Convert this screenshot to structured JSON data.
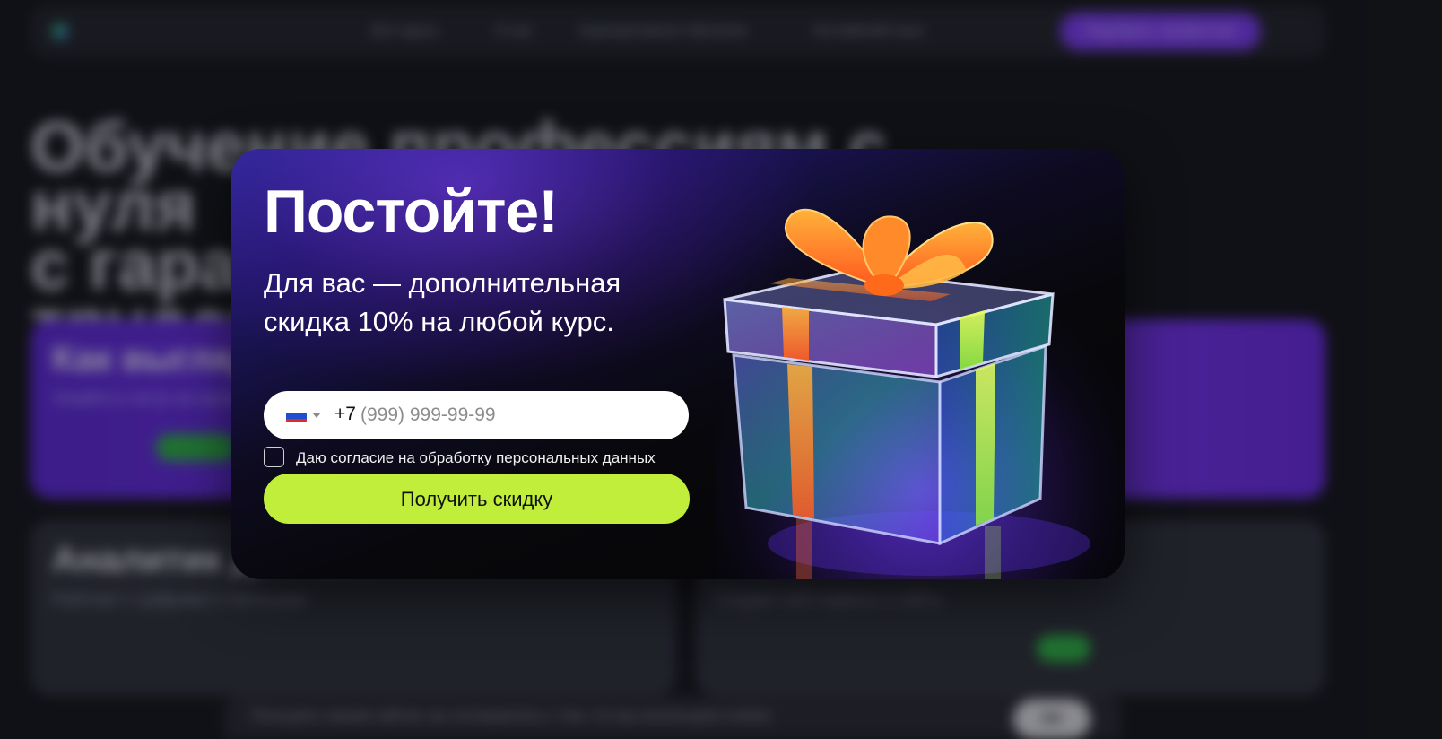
{
  "background": {
    "nav_items": [
      "Все курсы",
      "О нас",
      "Корпоративное обучение",
      "Английский язык"
    ],
    "cta_label": "Подобрать профессию",
    "headline": "Обучение профессиям с нуля\nс гарантией трудоустройства",
    "cards": [
      {
        "title": "Как выглядит",
        "subtitle": "Узнайте в тесте на профессию"
      },
      {
        "title": "Аналитик данных",
        "subtitle": "Работает с цифрами и таблицами"
      },
      {
        "title": "",
        "subtitle": "Создаёт веб-сервисы и сайты"
      }
    ],
    "cookie_text": "Пользуясь нашим сайтом, вы соглашаетесь с тем, что мы используем cookies",
    "cookie_ok": "OK"
  },
  "modal": {
    "title": "Постойте!",
    "subtitle": "Для вас — дополнительная скидка 10% на любой курс.",
    "phone": {
      "country_flag": "ru-flag",
      "prefix": "+7",
      "placeholder": "(999) 999-99-99",
      "value": ""
    },
    "consent_label": "Даю согласие на обработку персональных данных",
    "consent_checked": false,
    "submit_label": "Получить скидку"
  },
  "colors": {
    "accent_button": "#c1ee3a",
    "brand_purple": "#7a3cf0",
    "modal_dark": "#08080c"
  }
}
